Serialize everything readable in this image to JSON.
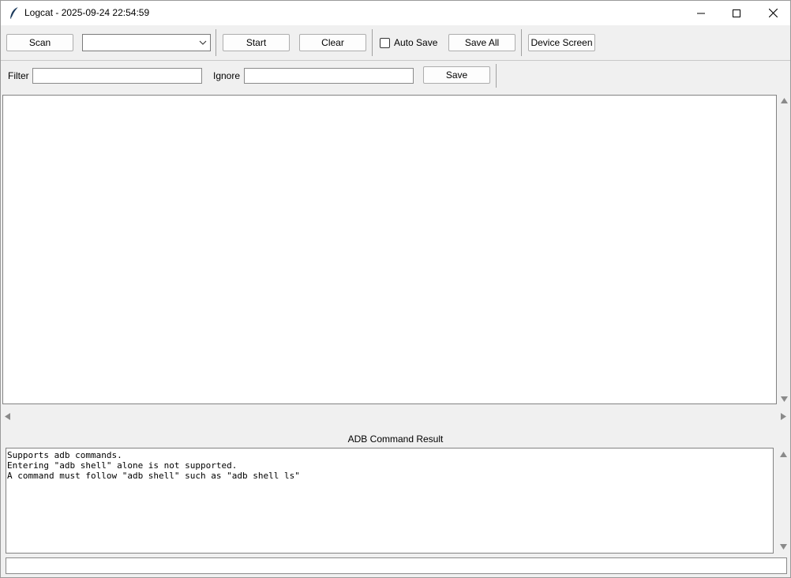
{
  "window": {
    "title": "Logcat - 2025-09-24 22:54:59"
  },
  "toolbar": {
    "scan_label": "Scan",
    "device_select_value": "",
    "start_label": "Start",
    "clear_label": "Clear",
    "auto_save_label": "Auto Save",
    "auto_save_checked": false,
    "save_all_label": "Save All",
    "device_screen_label": "Device Screen"
  },
  "filter_bar": {
    "filter_label": "Filter",
    "filter_value": "",
    "ignore_label": "Ignore",
    "ignore_value": "",
    "save_label": "Save"
  },
  "log_output": {
    "lines": []
  },
  "adb_result": {
    "title": "ADB Command Result",
    "lines": [
      "Supports adb commands.",
      "Entering \"adb shell\" alone is not supported.",
      "A command must follow \"adb shell\" such as \"adb shell ls\""
    ]
  },
  "command_input": {
    "value": ""
  },
  "icons": {
    "app": "feather-icon",
    "minimize": "minimize-icon",
    "maximize": "maximize-icon",
    "close": "close-icon",
    "dropdown": "chevron-down-icon"
  },
  "colors": {
    "window_bg": "#f0f0f0",
    "titlebar_bg": "#ffffff",
    "text_area_bg": "#ffffff"
  }
}
